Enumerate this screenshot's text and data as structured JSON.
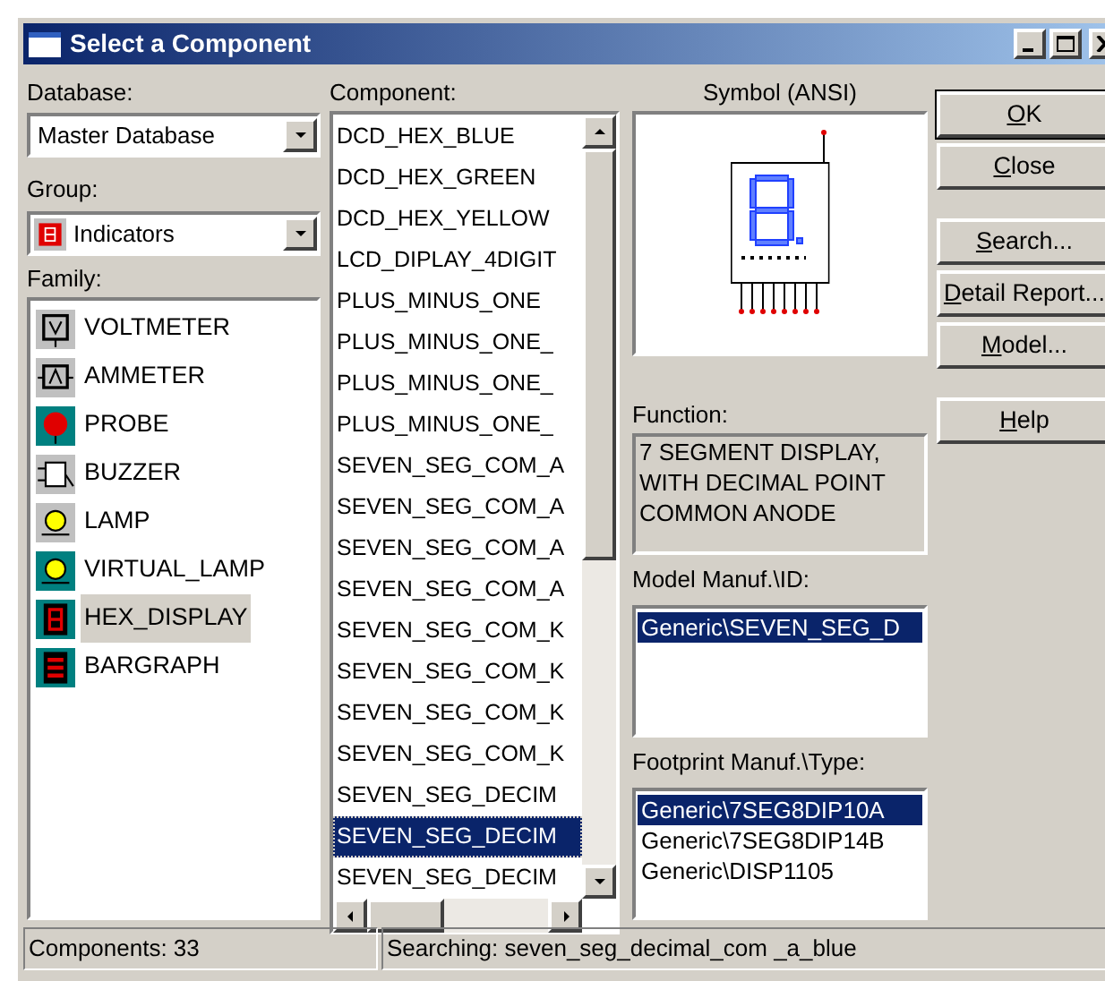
{
  "window": {
    "title": "Select a Component"
  },
  "database": {
    "label": "Database:",
    "value": "Master Database"
  },
  "group": {
    "label": "Group:",
    "value": "Indicators"
  },
  "family": {
    "label": "Family:",
    "items": [
      {
        "label": "VOLTMETER",
        "selected": false
      },
      {
        "label": "AMMETER",
        "selected": false
      },
      {
        "label": "PROBE",
        "selected": false
      },
      {
        "label": "BUZZER",
        "selected": false
      },
      {
        "label": "LAMP",
        "selected": false
      },
      {
        "label": "VIRTUAL_LAMP",
        "selected": false
      },
      {
        "label": "HEX_DISPLAY",
        "selected": true
      },
      {
        "label": "BARGRAPH",
        "selected": false
      }
    ]
  },
  "component": {
    "label": "Component:",
    "items": [
      {
        "label": "DCD_HEX_BLUE",
        "selected": false
      },
      {
        "label": "DCD_HEX_GREEN",
        "selected": false
      },
      {
        "label": "DCD_HEX_YELLOW",
        "selected": false
      },
      {
        "label": "LCD_DIPLAY_4DIGIT",
        "selected": false
      },
      {
        "label": "PLUS_MINUS_ONE",
        "selected": false
      },
      {
        "label": "PLUS_MINUS_ONE_",
        "selected": false
      },
      {
        "label": "PLUS_MINUS_ONE_",
        "selected": false
      },
      {
        "label": "PLUS_MINUS_ONE_",
        "selected": false
      },
      {
        "label": "SEVEN_SEG_COM_A",
        "selected": false
      },
      {
        "label": "SEVEN_SEG_COM_A",
        "selected": false
      },
      {
        "label": "SEVEN_SEG_COM_A",
        "selected": false
      },
      {
        "label": "SEVEN_SEG_COM_A",
        "selected": false
      },
      {
        "label": "SEVEN_SEG_COM_K",
        "selected": false
      },
      {
        "label": "SEVEN_SEG_COM_K",
        "selected": false
      },
      {
        "label": "SEVEN_SEG_COM_K",
        "selected": false
      },
      {
        "label": "SEVEN_SEG_COM_K",
        "selected": false
      },
      {
        "label": "SEVEN_SEG_DECIM",
        "selected": false
      },
      {
        "label": "SEVEN_SEG_DECIM",
        "selected": true
      },
      {
        "label": "SEVEN_SEG_DECIM",
        "selected": false
      }
    ]
  },
  "symbol": {
    "label": "Symbol (ANSI)"
  },
  "function": {
    "label": "Function:",
    "text": "7 SEGMENT DISPLAY, WITH DECIMAL POINT COMMON ANODE"
  },
  "model": {
    "label": "Model Manuf.\\ID:",
    "items": [
      {
        "label": "Generic\\SEVEN_SEG_D",
        "selected": true
      }
    ]
  },
  "footprint": {
    "label": "Footprint Manuf.\\Type:",
    "items": [
      {
        "label": "Generic\\7SEG8DIP10A",
        "selected": true
      },
      {
        "label": "Generic\\7SEG8DIP14B",
        "selected": false
      },
      {
        "label": "Generic\\DISP1105",
        "selected": false
      }
    ]
  },
  "buttons": [
    {
      "label": "OK",
      "default": true
    },
    {
      "label": "Close",
      "default": false
    },
    {
      "label": "Search...",
      "default": false
    },
    {
      "label": "Detail Report...",
      "default": false
    },
    {
      "label": "Model...",
      "default": false
    },
    {
      "label": "Help",
      "default": false
    }
  ],
  "status_bar": [
    "Components: 33",
    "Searching: seven_seg_decimal_com _a_blue"
  ]
}
